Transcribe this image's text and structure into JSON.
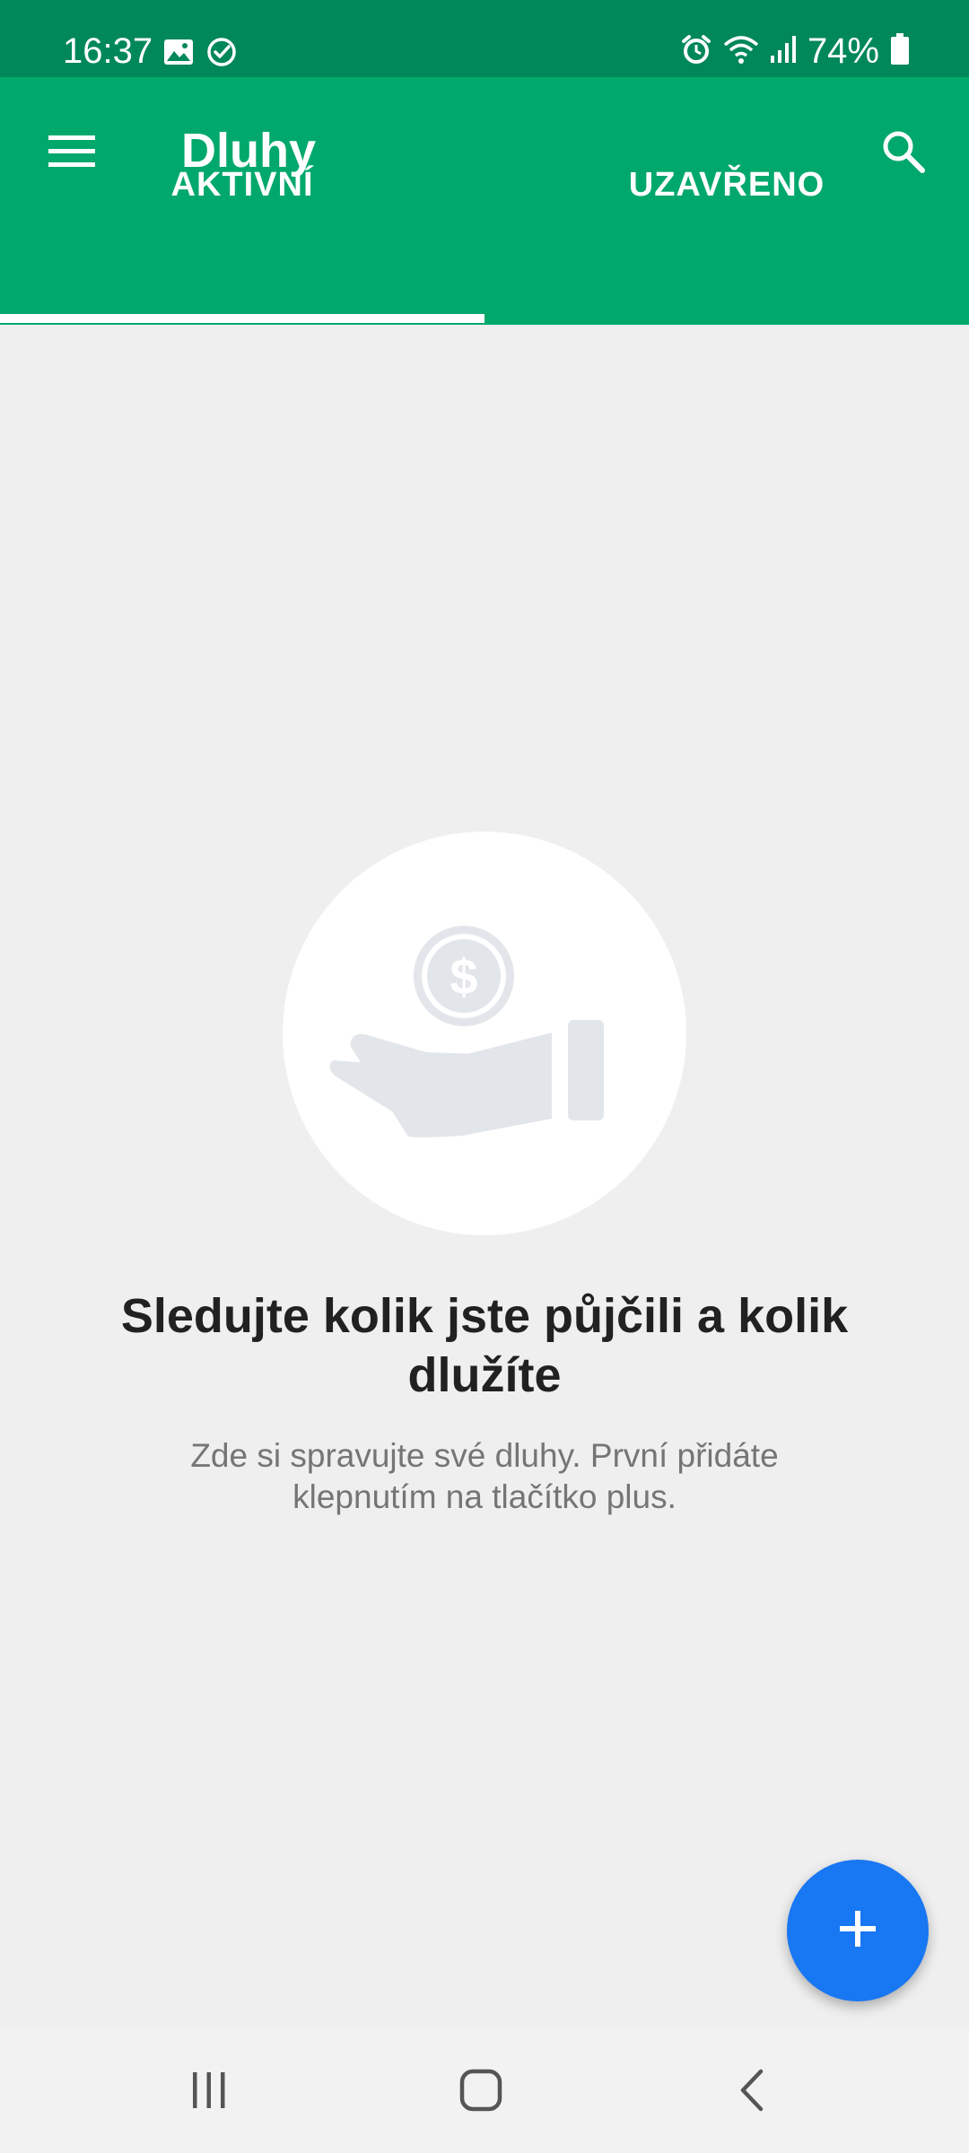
{
  "status_bar": {
    "time": "16:37",
    "battery": "74%",
    "icons": [
      "gallery-icon",
      "check-circle-icon",
      "alarm-icon",
      "wifi-icon",
      "signal-icon",
      "battery-icon"
    ]
  },
  "app_bar": {
    "title": "Dluhy",
    "menu_icon": "menu-icon",
    "search_icon": "search-icon"
  },
  "tabs": [
    {
      "label": "AKTIVNÍ",
      "selected": true
    },
    {
      "label": "UZAVŘENO",
      "selected": false
    }
  ],
  "empty_state": {
    "icon": "hand-coin-icon",
    "title": "Sledujte kolik jste půjčili a kolik dlužíte",
    "subtitle": "Zde si spravujte své dluhy. První přidáte klepnutím na tlačítko plus."
  },
  "fab": {
    "icon": "plus-icon"
  },
  "navigation": {
    "icons": [
      "recent-apps-icon",
      "home-icon",
      "back-icon"
    ]
  },
  "colors": {
    "status_bar": "#00875a",
    "app_bar": "#00a86b",
    "background": "#efefef",
    "fab": "#1877f2",
    "illustration": "#e2e6ea"
  }
}
